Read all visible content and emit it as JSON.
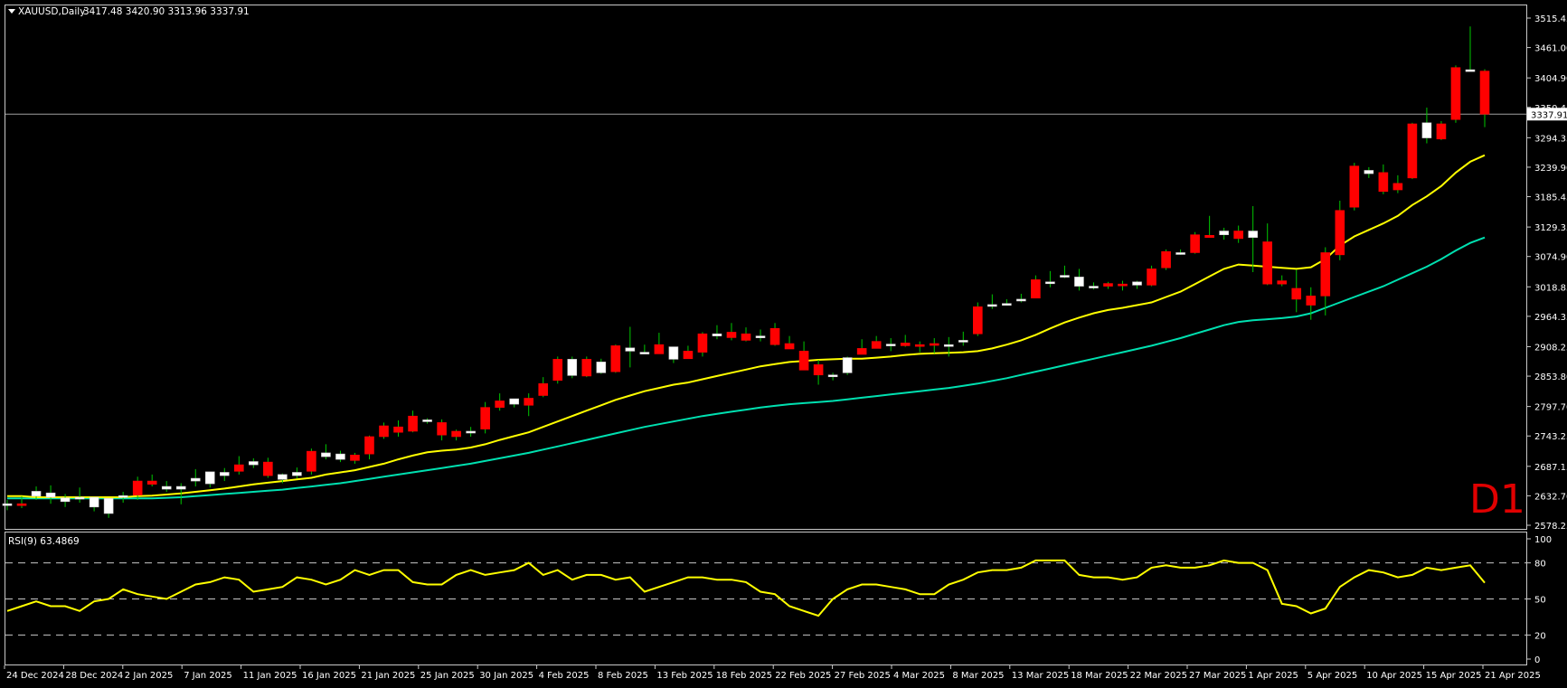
{
  "header": {
    "symbol": "XAUUSD,Daily",
    "ohlc": "3417.48 3420.90 3313.96 3337.91"
  },
  "timeframe_label": "D1",
  "colors": {
    "background": "#000000",
    "grid_border": "#c8c8c8",
    "bull_fill": "#ffffff",
    "bear_fill": "#ff0000",
    "wick": "#00c800",
    "ma_fast": "#ffff00",
    "ma_slow": "#00e0b0",
    "rsi_line": "#ffff00",
    "price_line": "#a0a0a0",
    "text": "#ffffff",
    "timeframe_label": "#e00000"
  },
  "chart_data": [
    {
      "type": "candlestick",
      "symbol": "XAUUSD",
      "timeframe": "Daily",
      "price_axis_ticks": [
        "3515.45",
        "3461.00",
        "3404.90",
        "3350.45",
        "3294.35",
        "3239.90",
        "3185.45",
        "3129.35",
        "3074.90",
        "3018.85",
        "2964.35",
        "2908.25",
        "2853.80",
        "2797.70",
        "2743.25",
        "2687.15",
        "2632.70",
        "2578.25"
      ],
      "ylim": [
        2578.25,
        3515.45
      ],
      "current_price": "3337.91",
      "date_axis_labels": [
        "24 Dec 2024",
        "28 Dec 2024",
        "2 Jan 2025",
        "7 Jan 2025",
        "11 Jan 2025",
        "16 Jan 2025",
        "21 Jan 2025",
        "25 Jan 2025",
        "30 Jan 2025",
        "4 Feb 2025",
        "8 Feb 2025",
        "13 Feb 2025",
        "18 Feb 2025",
        "22 Feb 2025",
        "27 Feb 2025",
        "4 Mar 2025",
        "8 Mar 2025",
        "13 Mar 2025",
        "18 Mar 2025",
        "22 Mar 2025",
        "27 Mar 2025",
        "1 Apr 2025",
        "5 Apr 2025",
        "10 Apr 2025",
        "15 Apr 2025",
        "21 Apr 2025"
      ],
      "candles": [
        [
          2615,
          2625,
          2606,
          2618
        ],
        [
          2618,
          2632,
          2610,
          2615
        ],
        [
          2632,
          2650,
          2625,
          2641
        ],
        [
          2630,
          2652,
          2618,
          2638
        ],
        [
          2622,
          2636,
          2612,
          2629
        ],
        [
          2628,
          2648,
          2620,
          2630
        ],
        [
          2612,
          2628,
          2604,
          2630
        ],
        [
          2600,
          2626,
          2592,
          2628
        ],
        [
          2630,
          2640,
          2620,
          2633
        ],
        [
          2660,
          2668,
          2625,
          2634
        ],
        [
          2660,
          2672,
          2650,
          2654
        ],
        [
          2645,
          2660,
          2640,
          2650
        ],
        [
          2645,
          2656,
          2617,
          2650
        ],
        [
          2660,
          2682,
          2650,
          2665
        ],
        [
          2655,
          2676,
          2648,
          2677
        ],
        [
          2670,
          2684,
          2660,
          2676
        ],
        [
          2690,
          2706,
          2672,
          2678
        ],
        [
          2690,
          2702,
          2684,
          2696
        ],
        [
          2695,
          2703,
          2666,
          2670
        ],
        [
          2663,
          2674,
          2656,
          2672
        ],
        [
          2670,
          2685,
          2665,
          2676
        ],
        [
          2715,
          2720,
          2672,
          2678
        ],
        [
          2705,
          2728,
          2700,
          2712
        ],
        [
          2700,
          2716,
          2695,
          2710
        ],
        [
          2708,
          2712,
          2692,
          2698
        ],
        [
          2742,
          2744,
          2700,
          2710
        ],
        [
          2762,
          2768,
          2738,
          2742
        ],
        [
          2760,
          2772,
          2742,
          2750
        ],
        [
          2780,
          2790,
          2750,
          2752
        ],
        [
          2770,
          2776,
          2766,
          2773
        ],
        [
          2768,
          2774,
          2735,
          2745
        ],
        [
          2752,
          2755,
          2735,
          2742
        ],
        [
          2750,
          2760,
          2742,
          2752
        ],
        [
          2796,
          2806,
          2748,
          2756
        ],
        [
          2808,
          2822,
          2790,
          2796
        ],
        [
          2802,
          2812,
          2796,
          2812
        ],
        [
          2813,
          2822,
          2780,
          2800
        ],
        [
          2840,
          2852,
          2815,
          2818
        ],
        [
          2885,
          2890,
          2840,
          2846
        ],
        [
          2855,
          2890,
          2850,
          2885
        ],
        [
          2885,
          2890,
          2852,
          2854
        ],
        [
          2860,
          2886,
          2858,
          2880
        ],
        [
          2910,
          2912,
          2860,
          2862
        ],
        [
          2900,
          2945,
          2870,
          2906
        ],
        [
          2898,
          2912,
          2895,
          2898
        ],
        [
          2912,
          2934,
          2898,
          2895
        ],
        [
          2885,
          2900,
          2878,
          2908
        ],
        [
          2900,
          2910,
          2890,
          2886
        ],
        [
          2932,
          2935,
          2890,
          2898
        ],
        [
          2928,
          2948,
          2922,
          2932
        ],
        [
          2935,
          2952,
          2920,
          2925
        ],
        [
          2932,
          2944,
          2918,
          2920
        ],
        [
          2925,
          2940,
          2918,
          2928
        ],
        [
          2942,
          2952,
          2910,
          2912
        ],
        [
          2914,
          2928,
          2910,
          2904
        ],
        [
          2900,
          2918,
          2880,
          2865
        ],
        [
          2875,
          2884,
          2838,
          2856
        ],
        [
          2853,
          2860,
          2846,
          2856
        ],
        [
          2860,
          2890,
          2856,
          2888
        ],
        [
          2905,
          2922,
          2896,
          2894
        ],
        [
          2918,
          2928,
          2912,
          2905
        ],
        [
          2910,
          2924,
          2900,
          2913
        ],
        [
          2915,
          2930,
          2908,
          2910
        ],
        [
          2912,
          2918,
          2898,
          2910
        ],
        [
          2914,
          2924,
          2896,
          2912
        ],
        [
          2910,
          2926,
          2890,
          2912
        ],
        [
          2920,
          2936,
          2910,
          2920
        ],
        [
          2982,
          2990,
          2928,
          2932
        ],
        [
          2985,
          3005,
          2978,
          2986
        ],
        [
          2988,
          2996,
          2984,
          2988
        ],
        [
          2996,
          3006,
          2990,
          2996
        ],
        [
          3032,
          3040,
          2998,
          2998
        ],
        [
          3026,
          3048,
          3018,
          3028
        ],
        [
          3040,
          3058,
          3035,
          3040
        ],
        [
          3020,
          3052,
          3012,
          3037
        ],
        [
          3018,
          3027,
          3014,
          3020
        ],
        [
          3025,
          3028,
          3015,
          3020
        ],
        [
          3024,
          3030,
          3012,
          3022
        ],
        [
          3022,
          3030,
          3015,
          3028
        ],
        [
          3052,
          3058,
          3020,
          3022
        ],
        [
          3084,
          3088,
          3050,
          3054
        ],
        [
          3082,
          3088,
          3078,
          3082
        ],
        [
          3115,
          3120,
          3080,
          3082
        ],
        [
          3114,
          3150,
          3110,
          3110
        ],
        [
          3115,
          3128,
          3106,
          3122
        ],
        [
          3122,
          3132,
          3100,
          3108
        ],
        [
          3110,
          3168,
          3046,
          3122
        ],
        [
          3102,
          3136,
          3022,
          3024
        ],
        [
          3030,
          3040,
          3020,
          3024
        ],
        [
          3016,
          3050,
          2972,
          2996
        ],
        [
          3002,
          3018,
          2958,
          2985
        ],
        [
          3082,
          3092,
          2966,
          3002
        ],
        [
          3160,
          3178,
          3068,
          3078
        ],
        [
          3242,
          3248,
          3160,
          3166
        ],
        [
          3228,
          3240,
          3220,
          3234
        ],
        [
          3230,
          3245,
          3190,
          3195
        ],
        [
          3210,
          3225,
          3192,
          3198
        ],
        [
          3320,
          3322,
          3218,
          3220
        ],
        [
          3294,
          3350,
          3284,
          3322
        ],
        [
          3320,
          3325,
          3290,
          3292
        ],
        [
          3424,
          3428,
          3322,
          3328
        ],
        [
          3420,
          3500,
          3418,
          3420
        ],
        [
          3417.48,
          3420.9,
          3313.96,
          3337.91
        ]
      ],
      "ma_fast": [
        2632,
        2632,
        2630,
        2630,
        2630,
        2630,
        2630,
        2630,
        2630,
        2632,
        2633,
        2635,
        2637,
        2640,
        2643,
        2646,
        2650,
        2654,
        2657,
        2660,
        2663,
        2666,
        2672,
        2676,
        2680,
        2686,
        2692,
        2700,
        2707,
        2713,
        2716,
        2718,
        2722,
        2728,
        2736,
        2743,
        2750,
        2760,
        2770,
        2780,
        2790,
        2800,
        2810,
        2818,
        2826,
        2832,
        2838,
        2842,
        2848,
        2854,
        2860,
        2866,
        2872,
        2876,
        2880,
        2882,
        2884,
        2885,
        2886,
        2886,
        2888,
        2890,
        2893,
        2895,
        2896,
        2897,
        2898,
        2900,
        2905,
        2912,
        2920,
        2930,
        2942,
        2953,
        2962,
        2970,
        2976,
        2980,
        2985,
        2990,
        3000,
        3010,
        3024,
        3038,
        3052,
        3060,
        3058,
        3056,
        3054,
        3052,
        3055,
        3070,
        3095,
        3112,
        3124,
        3136,
        3150,
        3170,
        3186,
        3205,
        3230,
        3250,
        3262
      ],
      "ma_slow": [
        2628,
        2628,
        2628,
        2628,
        2628,
        2628,
        2628,
        2628,
        2628,
        2628,
        2628,
        2629,
        2630,
        2632,
        2634,
        2636,
        2638,
        2640,
        2642,
        2644,
        2647,
        2650,
        2653,
        2656,
        2660,
        2664,
        2668,
        2672,
        2676,
        2680,
        2684,
        2688,
        2692,
        2697,
        2702,
        2707,
        2712,
        2718,
        2724,
        2730,
        2736,
        2742,
        2748,
        2754,
        2760,
        2765,
        2770,
        2775,
        2780,
        2784,
        2788,
        2792,
        2796,
        2799,
        2802,
        2804,
        2806,
        2808,
        2811,
        2814,
        2817,
        2820,
        2823,
        2826,
        2829,
        2832,
        2836,
        2840,
        2845,
        2850,
        2856,
        2862,
        2868,
        2874,
        2880,
        2886,
        2892,
        2898,
        2904,
        2910,
        2917,
        2924,
        2932,
        2940,
        2948,
        2954,
        2957,
        2959,
        2961,
        2964,
        2970,
        2980,
        2990,
        3000,
        3010,
        3020,
        3032,
        3044,
        3056,
        3070,
        3086,
        3100,
        3110
      ]
    },
    {
      "type": "line",
      "title": "RSI(9) 63.4869",
      "ylim": [
        0,
        100
      ],
      "y_ticks": [
        "100",
        "80",
        "50",
        "20",
        "0"
      ],
      "levels": [
        80,
        50,
        20
      ],
      "values": [
        40,
        44,
        48,
        44,
        44,
        40,
        48,
        50,
        58,
        54,
        52,
        50,
        56,
        62,
        64,
        68,
        66,
        56,
        58,
        60,
        68,
        66,
        62,
        66,
        74,
        70,
        74,
        74,
        64,
        62,
        62,
        70,
        74,
        70,
        72,
        74,
        80,
        70,
        74,
        66,
        70,
        70,
        66,
        68,
        56,
        60,
        64,
        68,
        68,
        66,
        66,
        64,
        56,
        54,
        44,
        40,
        36,
        50,
        58,
        62,
        62,
        60,
        58,
        54,
        54,
        62,
        66,
        72,
        74,
        74,
        76,
        82,
        82,
        82,
        70,
        68,
        68,
        66,
        68,
        76,
        78,
        76,
        76,
        78,
        82,
        80,
        80,
        74,
        46,
        44,
        38,
        42,
        60,
        68,
        74,
        72,
        68,
        70,
        76,
        74,
        76,
        78,
        63.4869
      ]
    }
  ]
}
